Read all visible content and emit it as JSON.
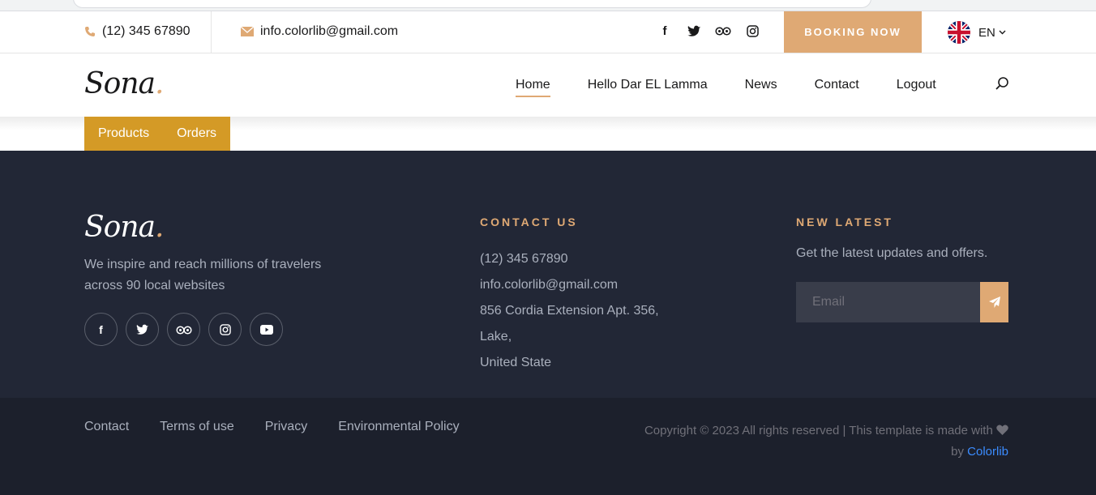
{
  "topbar": {
    "phone": "(12) 345 67890",
    "email": "info.colorlib@gmail.com",
    "booking_label": "BOOKING NOW",
    "lang": "EN"
  },
  "nav": {
    "logo": "Sona",
    "logo_dot": ".",
    "items": [
      {
        "label": "Home",
        "active": true
      },
      {
        "label": "Hello Dar EL Lamma"
      },
      {
        "label": "News"
      },
      {
        "label": "Contact"
      },
      {
        "label": "Logout"
      }
    ]
  },
  "subtabs": [
    "Products",
    "Orders"
  ],
  "footer": {
    "logo": "Sona",
    "logo_dot": ".",
    "about_line1": "We inspire and reach millions of travelers",
    "about_line2": "across 90 local websites",
    "contact_heading": "CONTACT US",
    "contact_phone": "(12) 345 67890",
    "contact_email": "info.colorlib@gmail.com",
    "contact_addr1": "856 Cordia Extension Apt. 356, Lake,",
    "contact_addr2": "United State",
    "news_heading": "NEW LATEST",
    "news_text": "Get the latest updates and offers.",
    "email_placeholder": "Email",
    "links": [
      "Contact",
      "Terms of use",
      "Privacy",
      "Environmental Policy"
    ],
    "copyright": "Copyright © 2023 All rights reserved | This template is made with",
    "copyright_by": "by",
    "copyright_link": "Colorlib"
  },
  "colors": {
    "accent": "#dfa974",
    "footer_bg": "#222736",
    "subtab_bg": "#d49a26"
  }
}
